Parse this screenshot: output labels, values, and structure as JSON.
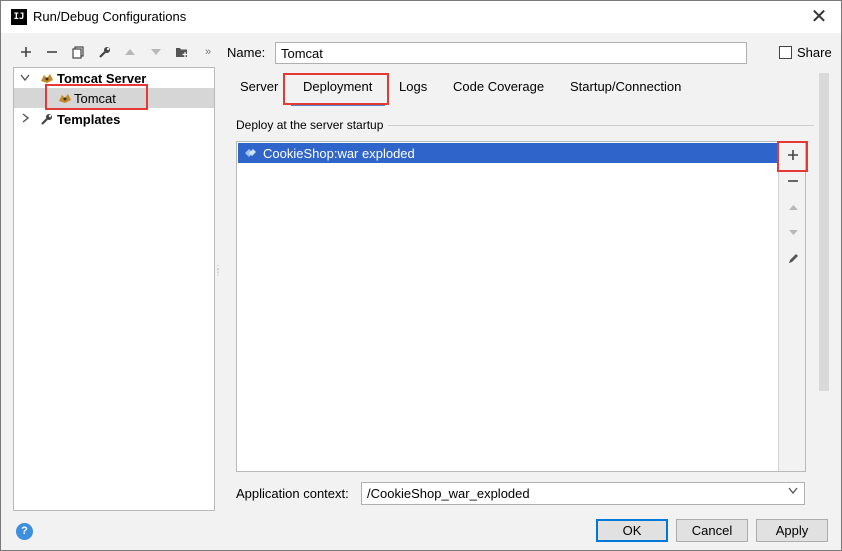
{
  "window": {
    "title": "Run/Debug Configurations",
    "app_icon": "IJ",
    "close_glyph": "✕"
  },
  "left_toolbar": {
    "icons": [
      "plus-icon",
      "minus-icon",
      "copy-icon",
      "wrench-icon",
      "arrow-up-icon",
      "arrow-down-icon",
      "folder-add-icon",
      "more-icon"
    ]
  },
  "tree": {
    "items": [
      {
        "label": "Tomcat Server",
        "icon": "tomcat-icon",
        "expanded": true
      },
      {
        "label": "Tomcat",
        "icon": "tomcat-icon",
        "selected": true
      },
      {
        "label": "Templates",
        "icon": "wrench-icon",
        "expanded": false
      }
    ]
  },
  "config": {
    "name_label": "Name:",
    "name_value": "Tomcat",
    "share_label": "Share",
    "tabs": [
      "Server",
      "Deployment",
      "Logs",
      "Code Coverage",
      "Startup/Connection"
    ],
    "active_tab": "Deployment"
  },
  "deployment": {
    "group_title": "Deploy at the server startup",
    "artifacts": [
      "CookieShop:war exploded"
    ],
    "side_buttons": [
      "plus-icon",
      "minus-icon",
      "arrow-up-icon",
      "arrow-down-icon",
      "edit-icon"
    ],
    "context_label": "Application context:",
    "context_value": "/CookieShop_war_exploded"
  },
  "footer": {
    "ok": "OK",
    "cancel": "Cancel",
    "apply": "Apply",
    "help": "?"
  },
  "colors": {
    "accent": "#2f65ca",
    "highlight": "#e53935",
    "tab_underline": "#4a88c7"
  }
}
